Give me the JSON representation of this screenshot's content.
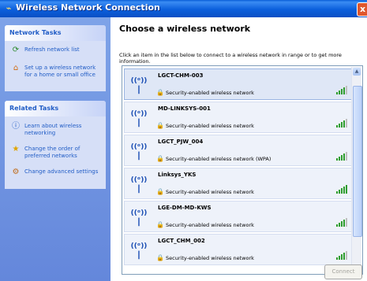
{
  "window": {
    "title": "Wireless Network Connection",
    "icon": "wireless-network-icon",
    "close_label": "x"
  },
  "network_tasks": {
    "header": "Network Tasks",
    "items": [
      {
        "label": "Refresh network list",
        "icon": "refresh-icon"
      },
      {
        "label": "Set up a wireless network for a home or small office",
        "icon": "setup-network-icon"
      }
    ]
  },
  "related_tasks": {
    "header": "Related Tasks",
    "items": [
      {
        "label": "Learn about wireless networking",
        "icon": "info-icon"
      },
      {
        "label": "Change the order of preferred networks",
        "icon": "star-icon"
      },
      {
        "label": "Change advanced settings",
        "icon": "settings-icon"
      }
    ]
  },
  "main": {
    "heading": "Choose a wireless network",
    "instructions": "Click an item in the list below to connect to a wireless network in range or to get more information."
  },
  "networks": [
    {
      "ssid": "LGCT-CHM-003",
      "security": "Security-enabled wireless network",
      "signal_bars": 4
    },
    {
      "ssid": "MD-LINKSYS-001",
      "security": "Security-enabled wireless network",
      "signal_bars": 4
    },
    {
      "ssid": "LGCT_PJW_004",
      "security": "Security-enabled wireless network (WPA)",
      "signal_bars": 4
    },
    {
      "ssid": "Linksys_YKS",
      "security": "Security-enabled wireless network",
      "signal_bars": 5
    },
    {
      "ssid": "LGE-DM-MD-KWS",
      "security": "Security-enabled wireless network",
      "signal_bars": 4
    },
    {
      "ssid": "LGCT_CHM_002",
      "security": "Security-enabled wireless network",
      "signal_bars": 4
    }
  ],
  "connect_button": "Connect",
  "colors": {
    "title_bar": "#0b5fdc",
    "task_link": "#215dc6",
    "left_pane": "#6f93df",
    "signal": "#2f9d2f"
  }
}
